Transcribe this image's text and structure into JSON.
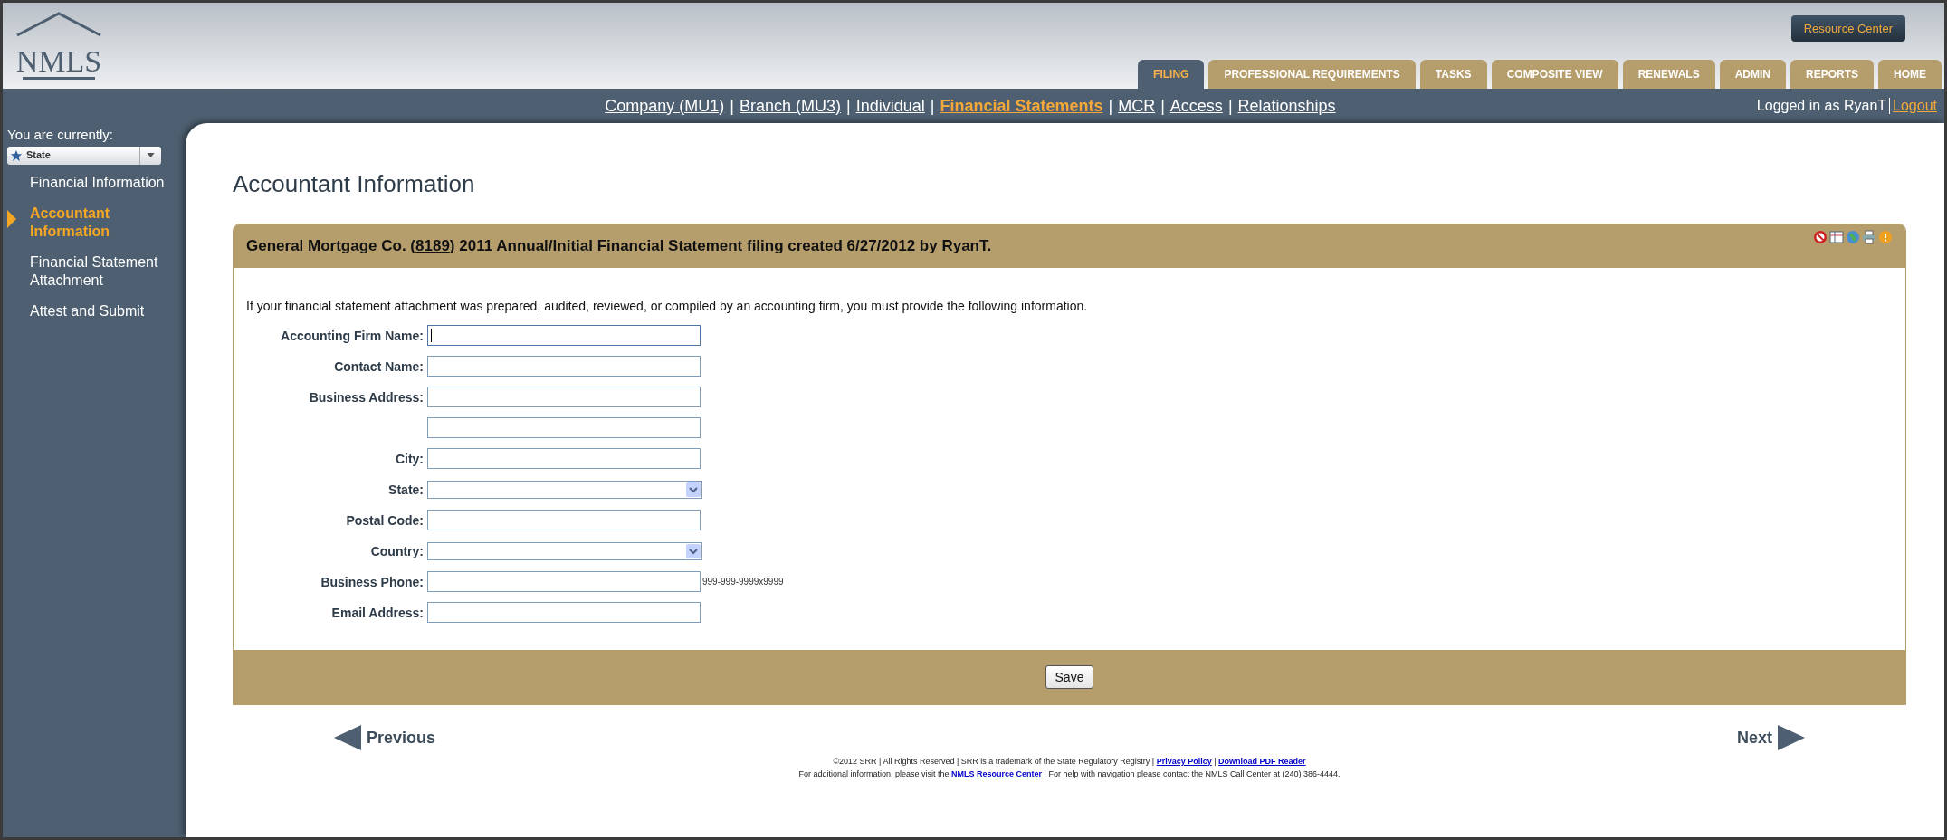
{
  "logo": {
    "text": "NMLS"
  },
  "resource_button": "Resource Center",
  "tabs": [
    {
      "label": "FILING",
      "selected": true
    },
    {
      "label": "PROFESSIONAL REQUIREMENTS",
      "selected": false
    },
    {
      "label": "TASKS",
      "selected": false
    },
    {
      "label": "COMPOSITE VIEW",
      "selected": false
    },
    {
      "label": "RENEWALS",
      "selected": false
    },
    {
      "label": "ADMIN",
      "selected": false
    },
    {
      "label": "REPORTS",
      "selected": false
    },
    {
      "label": "HOME",
      "selected": false
    }
  ],
  "subnav_separator": "|",
  "subnav": [
    {
      "label": "Company (MU1)",
      "selected": false
    },
    {
      "label": "Branch (MU3)",
      "selected": false
    },
    {
      "label": "Individual",
      "selected": false
    },
    {
      "label": "Financial Statements",
      "selected": true
    },
    {
      "label": "MCR",
      "selected": false
    },
    {
      "label": "Access",
      "selected": false
    },
    {
      "label": "Relationships",
      "selected": false
    }
  ],
  "user": {
    "text": "Logged in as RyanT",
    "logout": "Logout"
  },
  "sidebar": {
    "context_label": "You are currently:",
    "context_value": "State",
    "items": [
      {
        "label": "Financial Information",
        "selected": false
      },
      {
        "label": "Accountant Information",
        "selected": true
      },
      {
        "label": "Financial Statement Attachment",
        "selected": false
      },
      {
        "label": "Attest and Submit",
        "selected": false
      }
    ]
  },
  "page_title": "Accountant Information",
  "panel": {
    "title_before": "General Mortgage Co. (",
    "title_link": "8189",
    "title_after": ") 2011 Annual/Initial Financial Statement filing created 6/27/2012 by RyanT.",
    "intro": "If your financial statement attachment was prepared, audited, reviewed, or compiled by an accounting firm, you must provide the following information.",
    "fields": [
      {
        "label": "Accounting Firm Name:",
        "kind": "text",
        "focused": true
      },
      {
        "label": "Contact Name:",
        "kind": "text",
        "focused": false
      },
      {
        "label": "Business Address:",
        "kind": "text",
        "focused": false
      },
      {
        "kind": "text",
        "focused": false
      },
      {
        "label": "City:",
        "kind": "text",
        "focused": false
      },
      {
        "label": "State:",
        "kind": "select"
      },
      {
        "label": "Postal Code:",
        "kind": "text",
        "focused": false
      },
      {
        "label": "Country:",
        "kind": "select"
      },
      {
        "label": "Business Phone:",
        "kind": "text",
        "focused": false,
        "hint": "999-999-9999x9999"
      },
      {
        "label": "Email Address:",
        "kind": "text",
        "focused": false
      }
    ],
    "save": "Save"
  },
  "pager": {
    "previous": "Previous",
    "next": "Next"
  },
  "footer": [
    [
      {
        "kind": "text",
        "text": "©2012 SRR | All Rights Reserved | SRR is a trademark of the State Regulatory Registry | "
      },
      {
        "kind": "link",
        "text": "Privacy Policy"
      },
      {
        "kind": "text",
        "text": " | "
      },
      {
        "kind": "link",
        "text": "Download PDF Reader"
      }
    ],
    [
      {
        "kind": "text",
        "text": "For additional information, please visit the "
      },
      {
        "kind": "link",
        "text": "NMLS Resource Center"
      },
      {
        "kind": "text",
        "text": " | For help with navigation please contact the NMLS Call Center at (240) 386-4444."
      }
    ]
  ]
}
